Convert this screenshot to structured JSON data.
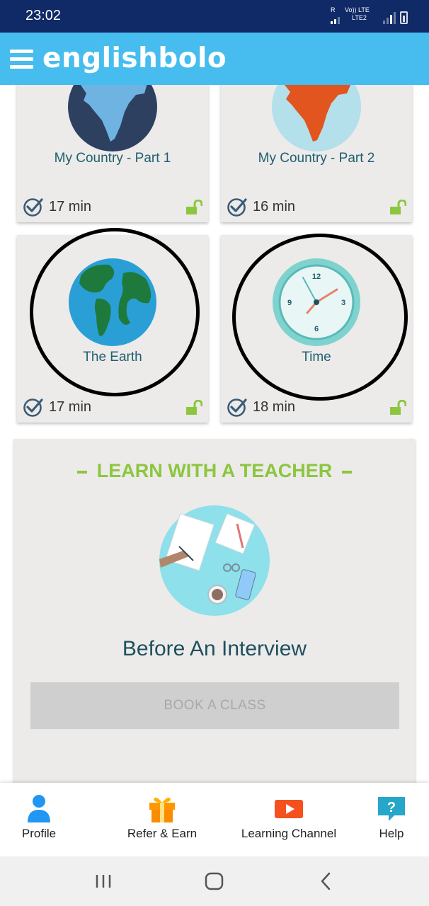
{
  "status_bar": {
    "time": "23:02",
    "carrier_label_top": "R",
    "volte_label": "Vo)) LTE",
    "lte2_label": "LTE2"
  },
  "header": {
    "brand": "englishbolo",
    "color": "#46bdee"
  },
  "lessons": [
    {
      "title": "My Country - Part 1",
      "duration": "17 min",
      "image": "india-map-dark-circle-icon"
    },
    {
      "title": "My Country - Part 2",
      "duration": "16 min",
      "image": "india-map-orange-icon"
    },
    {
      "title": "The Earth",
      "duration": "17 min",
      "image": "earth-globe-icon"
    },
    {
      "title": "Time",
      "duration": "18 min",
      "image": "wall-clock-icon"
    }
  ],
  "teacher_section": {
    "heading": "LEARN WITH A TEACHER",
    "title": "Before An Interview",
    "button_label": "BOOK A CLASS",
    "accent": "#8cc63f"
  },
  "bottom_nav": [
    {
      "label": "Profile",
      "icon": "person-icon"
    },
    {
      "label": "Refer & Earn",
      "icon": "gift-icon"
    },
    {
      "label": "Learning Channel",
      "icon": "play-video-icon"
    },
    {
      "label": "Help",
      "icon": "help-chat-icon"
    }
  ],
  "colors": {
    "status_bar": "#0f2a66",
    "title_text": "#1f5f6e",
    "lock": "#8cc63f"
  }
}
